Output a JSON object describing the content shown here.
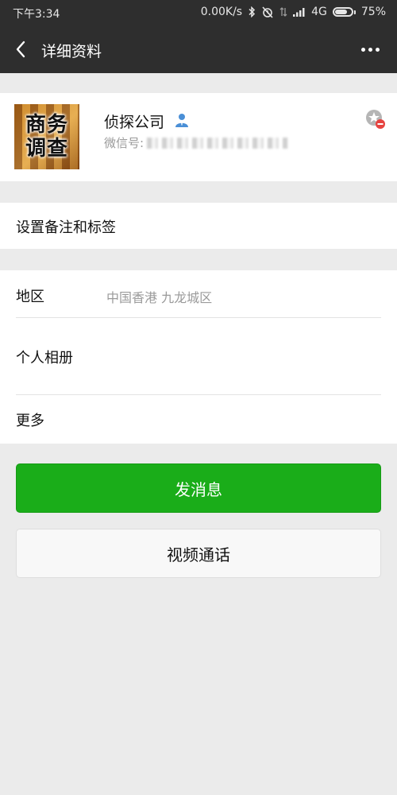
{
  "status_bar": {
    "time": "下午3:34",
    "network_speed": "0.00K/s",
    "network_type": "4G",
    "battery": "75%",
    "battery_level": 0.75,
    "icons": [
      "bluetooth-icon",
      "alarm-off-icon",
      "data-arrows-icon",
      "signal-icon",
      "battery-icon"
    ]
  },
  "nav": {
    "title": "详细资料",
    "back_icon": "back-arrow-icon",
    "more_icon": "more-dots-icon"
  },
  "profile": {
    "avatar_text": [
      "商务",
      "调查"
    ],
    "name": "侦探公司",
    "name_icon": "person-badge-icon",
    "wechat_id_label": "微信号:",
    "star_icon": "star-remove-icon"
  },
  "rows": {
    "remark": "设置备注和标签",
    "region_label": "地区",
    "region_value": "中国香港  九龙城区",
    "album": "个人相册",
    "more": "更多"
  },
  "buttons": {
    "send_message": "发消息",
    "video_call": "视频通话"
  },
  "colors": {
    "header_bg": "#2e2e2e",
    "primary_green": "#1aad19",
    "page_bg": "#ebebeb",
    "secondary_text": "#9a9a9a",
    "person_icon_blue": "#4a8fd6"
  }
}
